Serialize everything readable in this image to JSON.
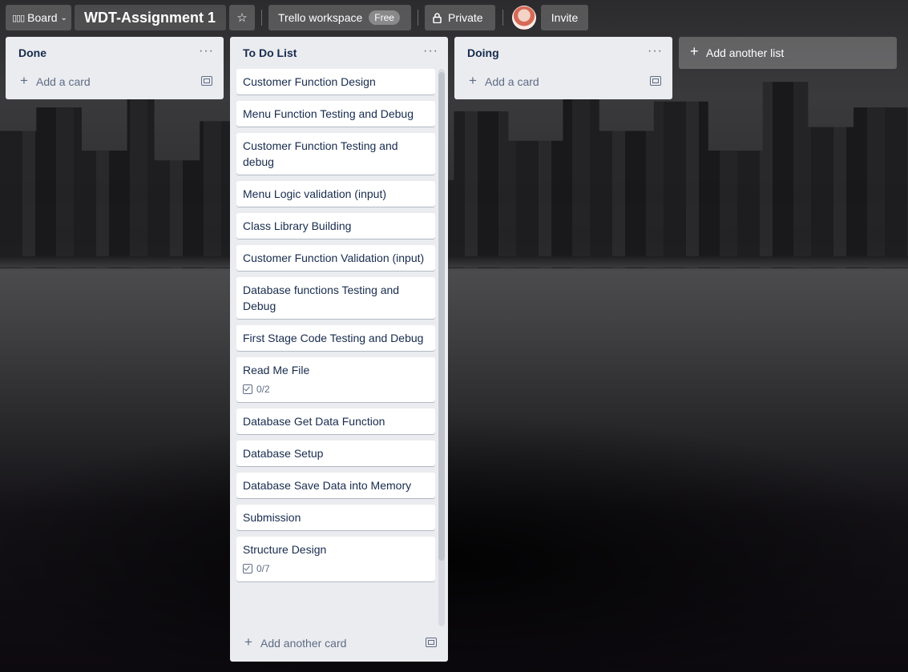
{
  "header": {
    "board_label": "Board",
    "board_title": "WDT-Assignment 1",
    "workspace_label": "Trello workspace",
    "workspace_badge": "Free",
    "visibility_label": "Private",
    "invite_label": "Invite"
  },
  "lists": {
    "done": {
      "title": "Done",
      "add_card": "Add a card"
    },
    "todo": {
      "title": "To Do List",
      "add_card": "Add another card",
      "cards": [
        {
          "title": "Customer Function Design"
        },
        {
          "title": "Menu Function Testing and Debug"
        },
        {
          "title": "Customer Function Testing and debug"
        },
        {
          "title": "Menu Logic validation (input)"
        },
        {
          "title": "Class Library Building"
        },
        {
          "title": "Customer Function Validation (input)"
        },
        {
          "title": "Database functions Testing and Debug"
        },
        {
          "title": "First Stage Code Testing and Debug"
        },
        {
          "title": "Read Me File",
          "checklist": "0/2"
        },
        {
          "title": "Database Get Data Function"
        },
        {
          "title": "Database Setup"
        },
        {
          "title": "Database Save Data into Memory"
        },
        {
          "title": "Submission"
        },
        {
          "title": "Structure Design",
          "checklist": "0/7"
        }
      ]
    },
    "doing": {
      "title": "Doing",
      "add_card": "Add a card"
    }
  },
  "add_list_label": "Add another list",
  "icons": {
    "board": "board-icon",
    "chevron": "chevron-down-icon",
    "star": "star-icon",
    "lock": "lock-icon",
    "menu": "more-horizontal-icon",
    "plus": "plus-icon",
    "template": "card-template-icon",
    "checklist": "checklist-icon"
  }
}
